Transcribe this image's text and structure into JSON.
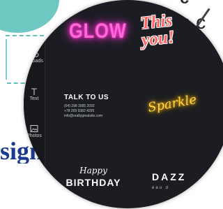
{
  "background": {
    "top_right_text": "to c",
    "top_right_text2": "c",
    "bottom_left_text": "sign"
  },
  "sidebar": {
    "items": [
      {
        "label": "Uploads",
        "icon": "cloud-upload-icon"
      },
      {
        "label": "Text",
        "icon": "text-icon"
      },
      {
        "label": "Photos",
        "icon": "image-icon"
      }
    ]
  },
  "templates": {
    "glow": "GLOW",
    "this_you_line1": "This",
    "this_you_line2": "you!",
    "talk": {
      "heading": "TALK TO US",
      "lines": [
        "(04) 298 3985 2092",
        "+78 209 9382 4295",
        "info@reallygreatsite.com"
      ]
    },
    "sparkle": "Sparkle",
    "happy": {
      "script": "Happy",
      "title": "BIRTHDAY"
    },
    "dazz": {
      "title": "DAZZ",
      "subtitle": "eau d"
    }
  },
  "colors": {
    "teal": "#6fc8c1",
    "panel_dark": "#1b1d22",
    "glow_pink": "#ff6ad5",
    "sparkle_yellow": "#ffd84a",
    "this_red": "#ff6767",
    "navy": "#1a3a8f"
  }
}
